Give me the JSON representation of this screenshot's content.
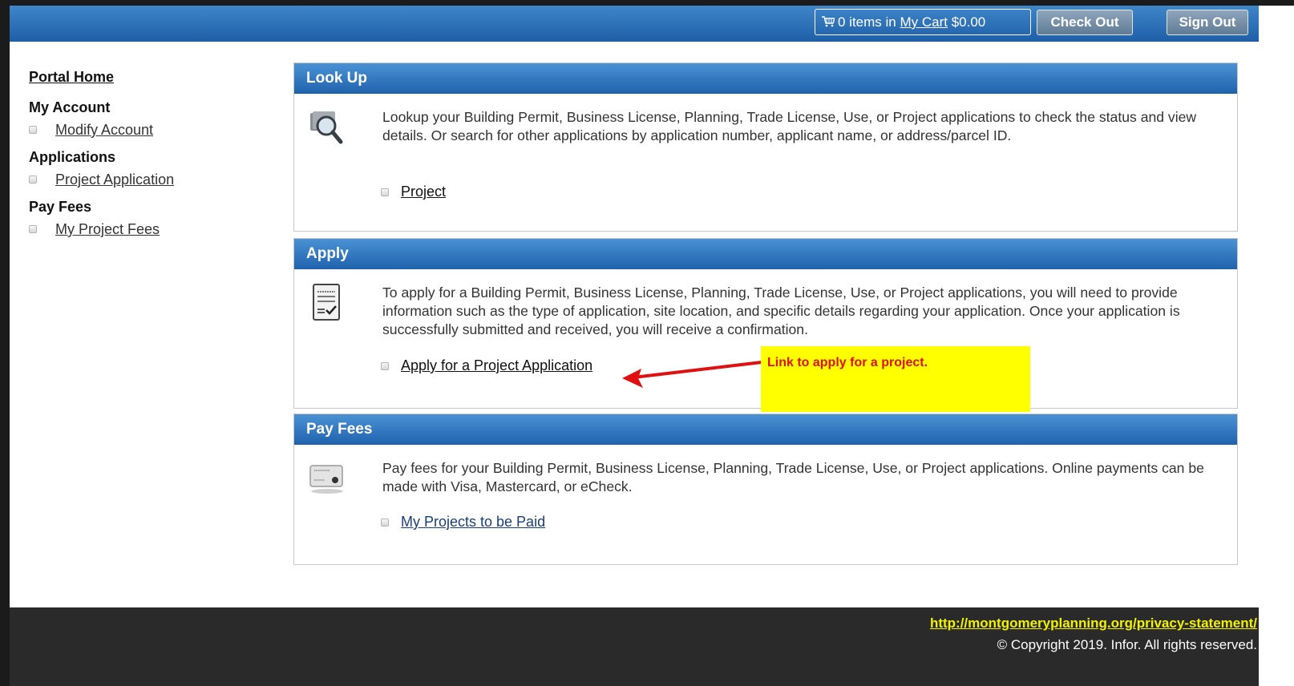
{
  "header": {
    "cart_count_text": "0 items in",
    "cart_link": "My Cart",
    "cart_total": "$0.00",
    "checkout_label": "Check Out",
    "signout_label": "Sign Out"
  },
  "sidebar": {
    "home": "Portal Home",
    "sections": [
      {
        "title": "My Account",
        "items": [
          "Modify Account"
        ]
      },
      {
        "title": "Applications",
        "items": [
          "Project Application"
        ]
      },
      {
        "title": "Pay Fees",
        "items": [
          "My Project Fees"
        ]
      }
    ]
  },
  "panels": {
    "lookup": {
      "title": "Look Up",
      "text": "Lookup your Building Permit, Business License, Planning, Trade License, Use, or Project applications to check the status and view details. Or search for other applications by application number, applicant name, or address/parcel ID.",
      "link": "Project"
    },
    "apply": {
      "title": "Apply",
      "text": "To apply for a Building Permit, Business License, Planning, Trade License, Use, or Project applications, you will need to provide information such as the type of application, site location, and specific details regarding your application. Once your application is successfully submitted and received, you will receive a confirmation.",
      "link": "Apply for a Project Application"
    },
    "payfees": {
      "title": "Pay Fees",
      "text": "Pay fees for your Building Permit, Business License, Planning, Trade License, Use, or Project applications. Online payments can be made with Visa, Mastercard, or eCheck.",
      "link": "My Projects to be Paid"
    }
  },
  "annotation": {
    "text": "Link to apply for a project.",
    "bg_color": "#ffff00",
    "text_color": "#e01010"
  },
  "footer": {
    "url": "http://montgomeryplanning.org/privacy-statement/",
    "copyright": "© Copyright 2019. Infor. All rights reserved."
  },
  "colors": {
    "header_blue": "#1e5fa8",
    "panel_blue": "#2f74bf",
    "footer_bg": "#2a2a2a"
  }
}
